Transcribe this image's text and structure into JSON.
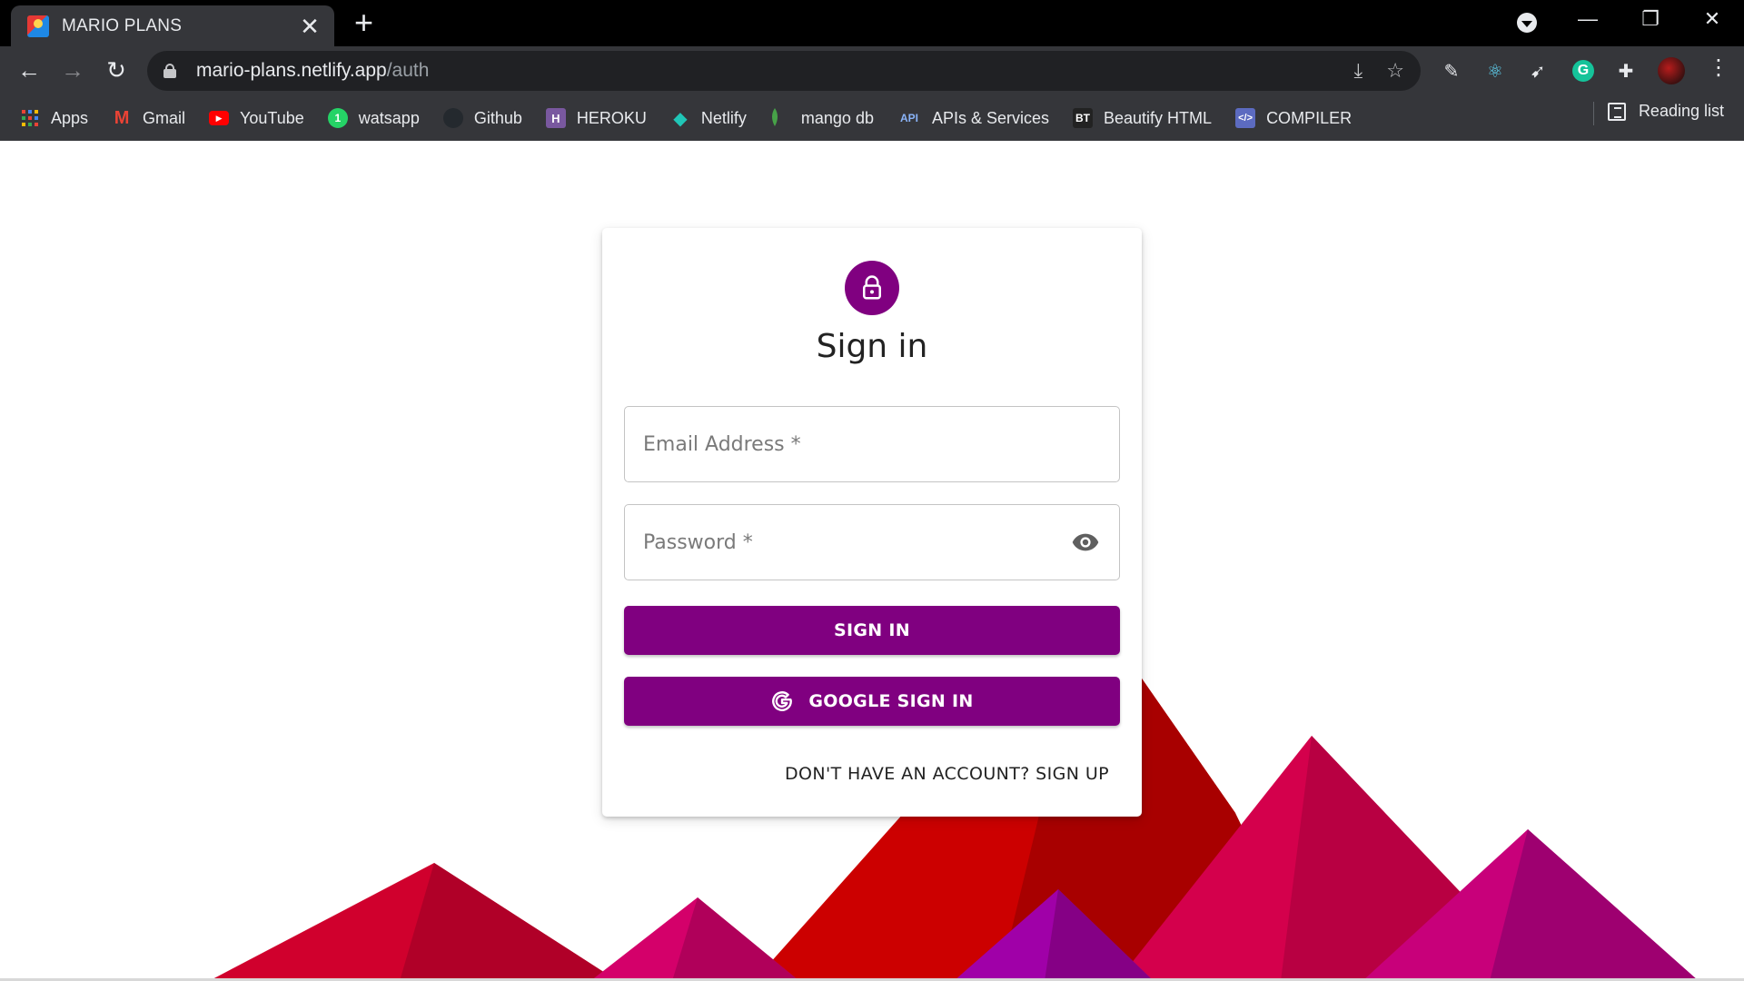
{
  "browser": {
    "tab": {
      "title": "MARIO PLANS",
      "close_glyph": "✕",
      "icon": "mario-favicon"
    },
    "new_tab_glyph": "+",
    "window_controls": {
      "minimize": "—",
      "restore": "❐",
      "close": "✕"
    },
    "url": {
      "host": "mario-plans.netlify.app",
      "path": "/auth"
    },
    "nav": {
      "back": "←",
      "forward": "→",
      "reload": "↻"
    },
    "omnibox_icons": [
      "install-icon",
      "star-icon"
    ],
    "extensions": [
      "pencil-icon",
      "react-devtools-icon",
      "extension-arrow-icon",
      "grammarly-icon",
      "puzzle-icon"
    ],
    "menu_glyph": "⋮"
  },
  "bookmarks": {
    "items": [
      {
        "label": "Apps",
        "icon": "apps-grid-icon",
        "color": "#ea4335"
      },
      {
        "label": "Gmail",
        "icon": "gmail-icon",
        "color": "#ea4335"
      },
      {
        "label": "YouTube",
        "icon": "youtube-icon",
        "color": "#ff0000"
      },
      {
        "label": "watsapp",
        "icon": "whatsapp-icon",
        "color": "#25d366"
      },
      {
        "label": "Github",
        "icon": "github-icon",
        "color": "#24292e"
      },
      {
        "label": "HEROKU",
        "icon": "heroku-icon",
        "color": "#79589f"
      },
      {
        "label": "Netlify",
        "icon": "netlify-icon",
        "color": "#20c6b7"
      },
      {
        "label": "mango db",
        "icon": "mongodb-leaf-icon",
        "color": "#47a248"
      },
      {
        "label": "APIs & Services",
        "icon": "api-icon",
        "color": "#4285f4"
      },
      {
        "label": "Beautify HTML",
        "icon": "bt-icon",
        "color": "#222222"
      },
      {
        "label": "COMPILER",
        "icon": "code-icon",
        "color": "#5c6bc0"
      }
    ],
    "reading_list": "Reading list"
  },
  "page": {
    "title": "Sign in",
    "email": {
      "placeholder": "Email Address *",
      "value": ""
    },
    "password": {
      "placeholder": "Password *",
      "value": ""
    },
    "sign_in_button": "SIGN IN",
    "google_button": "GOOGLE SIGN IN",
    "signup_link": "DON'T HAVE AN ACCOUNT? SIGN UP",
    "accent_color": "#800080"
  }
}
